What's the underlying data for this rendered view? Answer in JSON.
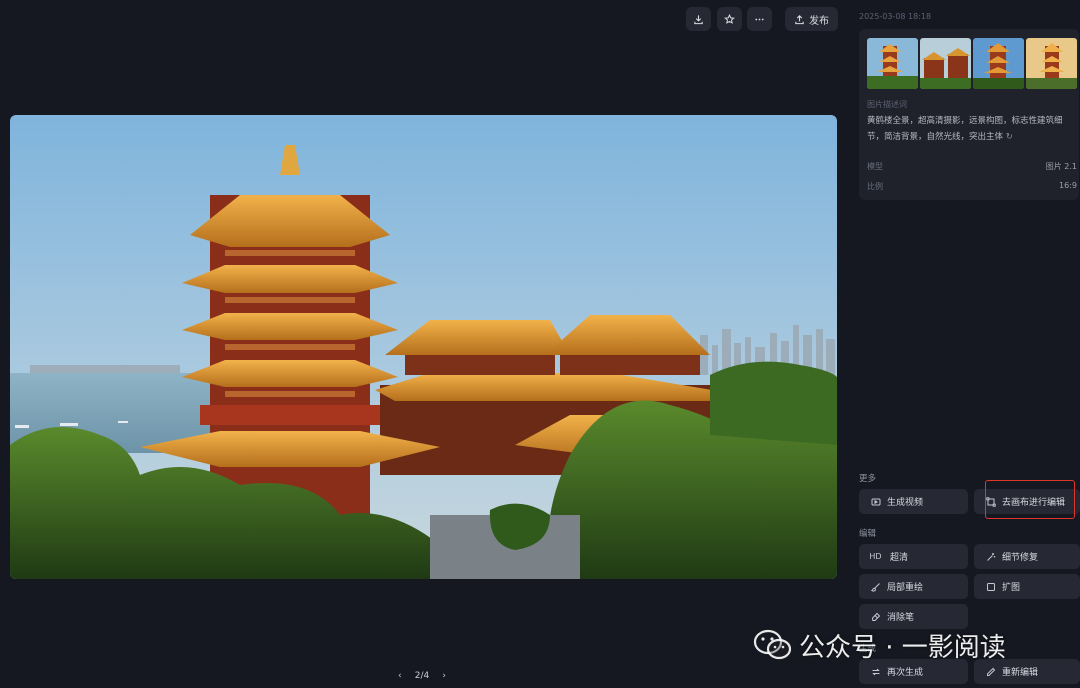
{
  "toolbar": {
    "download_icon": "download-icon",
    "favorite_icon": "star-icon",
    "more_icon": "more-icon",
    "publish_label": "发布"
  },
  "pager": {
    "current": "2/4"
  },
  "info": {
    "timestamp": "2025-03-08 18:18",
    "prompt_label": "图片描述词",
    "prompt_text": "黄鹤楼全景，超高清摄影，远景构图，标志性建筑细节，简洁背景，自然光线，突出主体",
    "model_label": "模型",
    "model_value": "图片 2.1",
    "ratio_label": "比例",
    "ratio_value": "16:9"
  },
  "more": {
    "label": "更多",
    "generate_video": "生成视频",
    "canvas_edit": "去画布进行编辑"
  },
  "edit": {
    "label": "编辑",
    "hd_icon_text": "HD",
    "hd": "超清",
    "detail_fix": "细节修复",
    "local_redraw": "局部重绘",
    "expand": "扩图",
    "eraser": "消除笔"
  },
  "regen": {
    "label": "生成",
    "regenerate": "再次生成",
    "re_edit": "重新编辑"
  },
  "watermark": {
    "text": "公众号 · 一影阅读"
  },
  "colors": {
    "background": "#161821",
    "panel": "#1f212b",
    "button": "#262833",
    "highlight": "#e0352b"
  }
}
